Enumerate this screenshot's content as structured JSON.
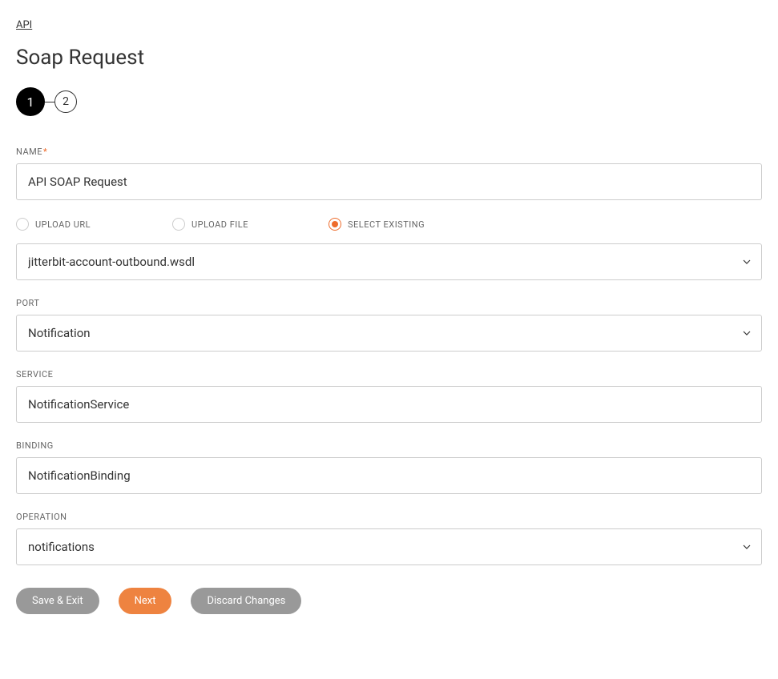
{
  "breadcrumb": "API",
  "page_title": "Soap Request",
  "stepper": {
    "step1": "1",
    "step2": "2"
  },
  "name": {
    "label": "NAME",
    "value": "API SOAP Request"
  },
  "source": {
    "options": {
      "upload_url": "UPLOAD URL",
      "upload_file": "UPLOAD FILE",
      "select_existing": "SELECT EXISTING"
    },
    "value": "jitterbit-account-outbound.wsdl"
  },
  "port": {
    "label": "PORT",
    "value": "Notification"
  },
  "service": {
    "label": "SERVICE",
    "value": "NotificationService"
  },
  "binding": {
    "label": "BINDING",
    "value": "NotificationBinding"
  },
  "operation": {
    "label": "OPERATION",
    "value": "notifications"
  },
  "buttons": {
    "save_exit": "Save & Exit",
    "next": "Next",
    "discard": "Discard Changes"
  }
}
